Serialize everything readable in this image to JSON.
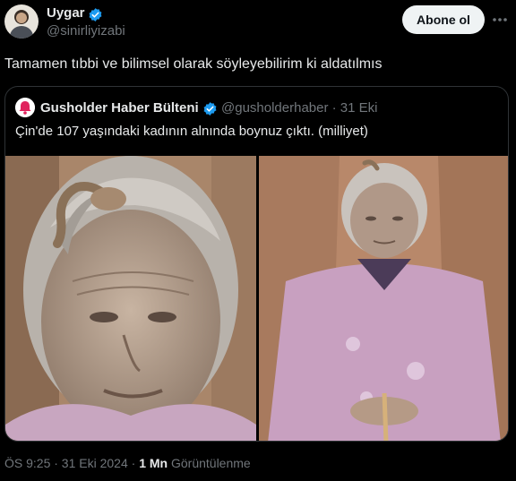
{
  "author": {
    "name": "Uygar",
    "handle": "@sinirliyizabi",
    "verified": true
  },
  "follow_label": "Abone ol",
  "tweet_text": "Tamamen tıbbi ve bilimsel olarak söyleyebilirim ki aldatılmıs",
  "quote": {
    "name": "Gusholder Haber Bülteni",
    "meta": "@gusholderhaber · 31 Eki",
    "text": "Çin'de 107 yaşındaki kadının alnında boynuz çıktı. (milliyet)"
  },
  "footer": {
    "time_date": "ÖS 9:25 · 31 Eki 2024 · ",
    "views_count": "1 Mn",
    "views_label": " Görüntülenme"
  },
  "colors": {
    "background": "#000000",
    "verified_blue": "#1d9bf0",
    "secondary_text": "#71767b",
    "border": "#2f3336"
  },
  "icons": [
    "avatar",
    "verified-badge-icon",
    "more-options-icon",
    "bell-logo-icon"
  ]
}
